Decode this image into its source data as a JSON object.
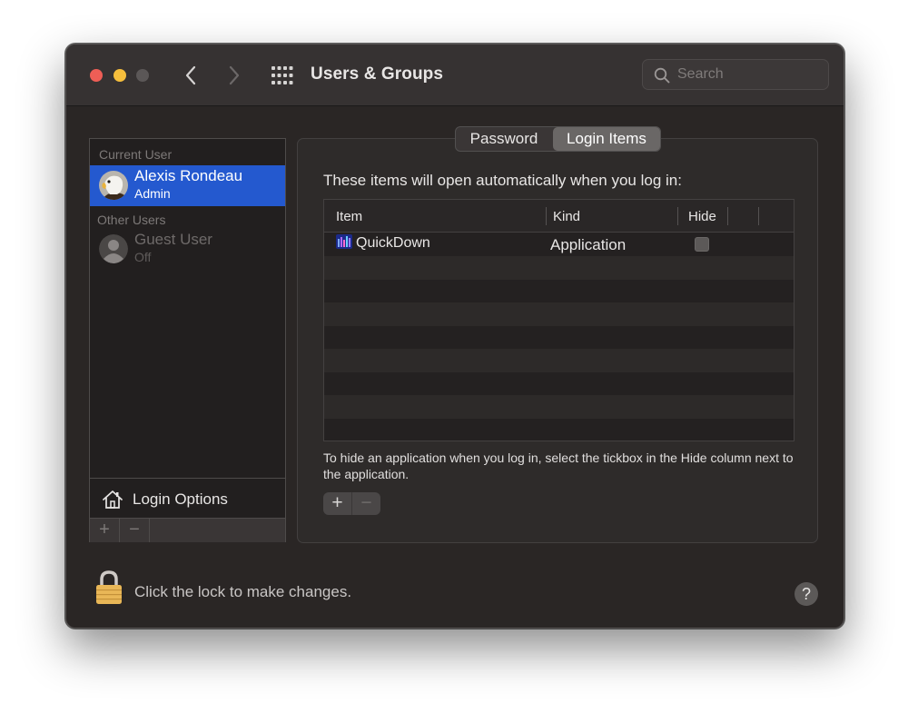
{
  "window": {
    "title": "Users & Groups",
    "search_placeholder": "Search"
  },
  "sidebar": {
    "current_user_label": "Current User",
    "current_user": {
      "name": "Alexis Rondeau",
      "role": "Admin"
    },
    "other_users_label": "Other Users",
    "other_users": [
      {
        "name": "Guest User",
        "role": "Off"
      }
    ],
    "login_options_label": "Login Options",
    "add_symbol": "+",
    "remove_symbol": "−"
  },
  "tabs": [
    {
      "label": "Password"
    },
    {
      "label": "Login Items",
      "active": true
    }
  ],
  "login_items": {
    "intro": "These items will open automatically when you log in:",
    "columns": [
      "Item",
      "Kind",
      "Hide"
    ],
    "rows": [
      {
        "item": "QuickDown",
        "kind": "Application",
        "hide": false
      }
    ],
    "help_text": "To hide an application when you log in, select the tickbox in the Hide column next to the application.",
    "add_symbol": "+",
    "remove_symbol": "−"
  },
  "footer": {
    "lock_text": "Click the lock to make changes.",
    "help_symbol": "?"
  },
  "colors": {
    "selection": "#2459cf",
    "close": "#ee5e56",
    "minimize": "#f5be3c",
    "lock_gold": "#e9b757"
  }
}
